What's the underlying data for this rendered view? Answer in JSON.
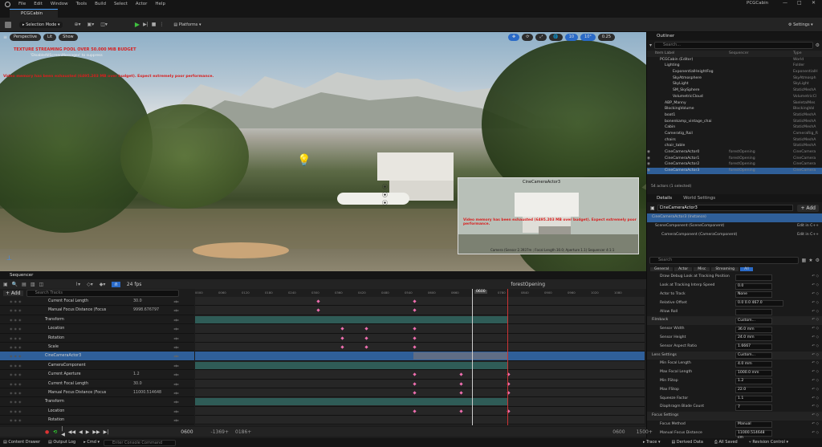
{
  "menu": [
    "File",
    "Edit",
    "Window",
    "Tools",
    "Build",
    "Select",
    "Actor",
    "Help"
  ],
  "window_title": "PCGCabin",
  "project_tab": "PCGCabin",
  "toolbar": {
    "selection_mode": "Selection Mode",
    "platforms": "Platforms",
    "settings": "Settings"
  },
  "viewport": {
    "perspective": "Perspective",
    "lit": "Lit",
    "show": "Show",
    "fov": "0.25",
    "grid": "10",
    "angle": "10°",
    "scale": "0.25",
    "warn1": "TEXTURE STREAMING POOL OVER 50.000 MiB BUDGET",
    "warn1b": "'DisableAllScreenMessages' to suppress",
    "warn2": "Video memory has been exhausted (6495.203 MB over budget). Expect extremely poor performance.",
    "pip_label": "CineCameraActor3",
    "pip_warn": "Video memory has been exhausted (6495.203 MB over budget). Expect extremely poor performance.",
    "pip_info": "Camera (Sensor 2.3937m ; Focal Length 30.0; Aperture 1.1) Sequencer 4:1:1"
  },
  "outliner": {
    "title": "Outliner",
    "search_placeholder": "Search...",
    "col_label": "Item Label",
    "col_seq": "Sequencer",
    "col_type": "Type",
    "items": [
      {
        "label": "PCGCabin (Editor)",
        "seq": "",
        "type": "World"
      },
      {
        "label": "Lighting",
        "seq": "",
        "type": "Folder"
      },
      {
        "label": "ExponentialHeightFog",
        "seq": "",
        "type": "ExponentialH"
      },
      {
        "label": "SkyAtmosphere",
        "seq": "",
        "type": "SkyAtmosph"
      },
      {
        "label": "SkyLight",
        "seq": "",
        "type": "SkyLight"
      },
      {
        "label": "SM_SkySphere",
        "seq": "",
        "type": "StaticMeshA"
      },
      {
        "label": "VolumetricCloud",
        "seq": "",
        "type": "VolumetricCl"
      },
      {
        "label": "ABP_Manny",
        "seq": "",
        "type": "SkeletalMes"
      },
      {
        "label": "BlockingVolume",
        "seq": "",
        "type": "BlockingVol"
      },
      {
        "label": "boat1",
        "seq": "",
        "type": "StaticMeshA"
      },
      {
        "label": "bonenkamp_vintage_chai",
        "seq": "",
        "type": "StaticMeshA"
      },
      {
        "label": "Cabin",
        "seq": "",
        "type": "StaticMeshA"
      },
      {
        "label": "Cameratig_Rail",
        "seq": "",
        "type": "CameraRig_R"
      },
      {
        "label": "chairs",
        "seq": "",
        "type": "StaticMeshA"
      },
      {
        "label": "chair_table",
        "seq": "",
        "type": "StaticMeshA"
      },
      {
        "label": "CineCameraActor0",
        "seq": "forestOpening",
        "type": "CineCamera"
      },
      {
        "label": "CineCameraActor1",
        "seq": "forestOpening",
        "type": "CineCamera"
      },
      {
        "label": "CineCameraActor2",
        "seq": "forestOpening",
        "type": "CineCamera"
      },
      {
        "label": "CineCameraActor3",
        "seq": "forestOpening",
        "type": "CineCamera"
      }
    ],
    "count": "54 actors (1 selected)"
  },
  "details": {
    "tab": "Details",
    "tab2": "World Settings",
    "actor": "CineCameraActor3",
    "add": "+ Add",
    "instance": "CineCameraActor3 (Instance)",
    "comp1": "SceneComponent (SceneComponent)",
    "comp2": "CameraComponent (CameraComponent)",
    "edit": "Edit in C++",
    "search_placeholder": "Search",
    "filters": [
      "General",
      "Actor",
      "Misc",
      "Streaming",
      "All"
    ],
    "rows": [
      {
        "label": "Draw Debug Look at Tracking Position",
        "value": ""
      },
      {
        "label": "Look at Tracking Interp Speed",
        "value": "0.0"
      },
      {
        "label": "Actor to Track",
        "value": "None"
      },
      {
        "label": "Relative Offset",
        "value": "0.0   0.0   467.0"
      },
      {
        "label": "Allow Roll",
        "value": ""
      },
      {
        "label": "Filmback",
        "value": "Custom...",
        "cat": true
      },
      {
        "label": "Sensor Width",
        "value": "36.0 mm"
      },
      {
        "label": "Sensor Height",
        "value": "24.0 mm"
      },
      {
        "label": "Sensor Aspect Ratio",
        "value": "1.6667"
      },
      {
        "label": "Lens Settings",
        "value": "Custom...",
        "cat": true
      },
      {
        "label": "Min Focal Length",
        "value": "4.0 mm"
      },
      {
        "label": "Max Focal Length",
        "value": "1000.0 mm"
      },
      {
        "label": "Min FStop",
        "value": "1.2"
      },
      {
        "label": "Max FStop",
        "value": "22.0"
      },
      {
        "label": "Squeeze Factor",
        "value": "1.1"
      },
      {
        "label": "Diaphragm Blade Count",
        "value": "7"
      },
      {
        "label": "Focus Settings",
        "value": "",
        "cat": true
      },
      {
        "label": "Focus Method",
        "value": "Manual"
      },
      {
        "label": "Manual Focus Distance",
        "value": "11000.514648 cm"
      }
    ]
  },
  "sequencer": {
    "title": "Sequencer",
    "add": "+ Add",
    "search_placeholder": "Search Tracks",
    "fps": "24 fps",
    "sequence_name": "forestOpening",
    "playhead": "0600",
    "start": "0600",
    "range_start": "-1369+",
    "range_end": "0186+",
    "end_a": "0600",
    "end_b": "1500+",
    "tracks": [
      {
        "label": "Current Focal Length",
        "value": "30.0",
        "indent": 60
      },
      {
        "label": "Manual Focus Distance (Focus",
        "value": "9998.676797",
        "indent": 60
      },
      {
        "label": "Transform",
        "value": "",
        "indent": 56
      },
      {
        "label": "Location",
        "value": "",
        "indent": 60
      },
      {
        "label": "Rotation",
        "value": "",
        "indent": 60
      },
      {
        "label": "Scale",
        "value": "",
        "indent": 60
      },
      {
        "label": "CineCameraActor3",
        "value": "",
        "indent": 56,
        "sel": true
      },
      {
        "label": "CameraComponent",
        "value": "",
        "indent": 60
      },
      {
        "label": "Current Aperture",
        "value": "1.2",
        "indent": 60
      },
      {
        "label": "Current Focal Length",
        "value": "30.0",
        "indent": 60
      },
      {
        "label": "Manual Focus Distance (Focus",
        "value": "11000.514648",
        "indent": 60
      },
      {
        "label": "Transform",
        "value": "",
        "indent": 56
      },
      {
        "label": "Location",
        "value": "",
        "indent": 60
      },
      {
        "label": "Rotation",
        "value": "",
        "indent": 60
      }
    ],
    "ticks": [
      "0000",
      "0060",
      "0120",
      "0180",
      "0240",
      "0300",
      "0360",
      "0420",
      "0480",
      "0540",
      "0600",
      "0660",
      "0720",
      "0780",
      "0840",
      "0900",
      "0960",
      "1020",
      "1080"
    ]
  },
  "status": {
    "content_drawer": "Content Drawer",
    "output_log": "Output Log",
    "cmd": "Cmd",
    "cmd_placeholder": "Enter Console Command",
    "trace": "Trace",
    "derived": "Derived Data",
    "saved": "All Saved",
    "revision": "Revision Control"
  }
}
